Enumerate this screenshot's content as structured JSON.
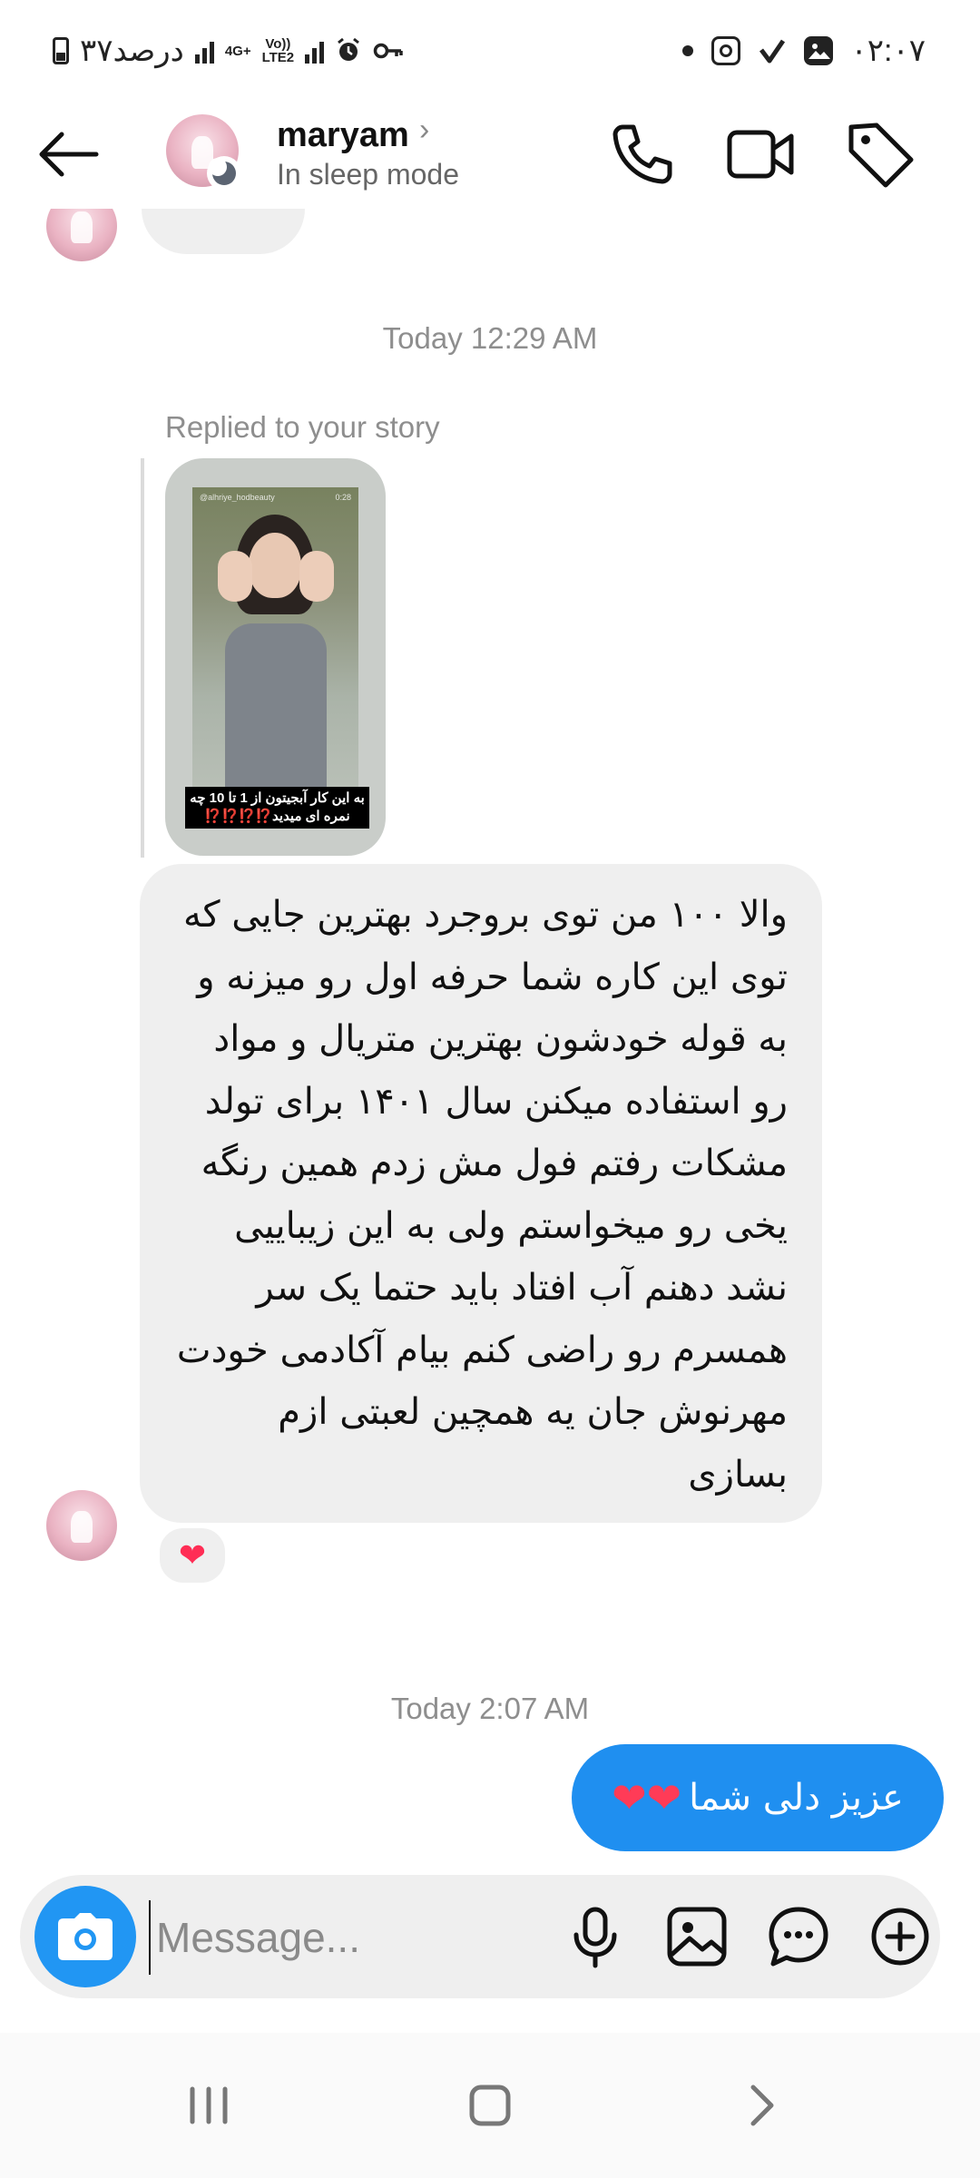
{
  "status_bar": {
    "battery_text": "۳۷درصد",
    "network_4g": "4G+",
    "network_volte": "Vo))",
    "network_lte": "LTE2",
    "time": "۰۲:۰۷"
  },
  "header": {
    "name": "maryam",
    "status": "In sleep mode"
  },
  "chat": {
    "timestamp_1": "Today 12:29 AM",
    "replied_label": "Replied to your story",
    "story": {
      "handle": "@alhriye_hodbeauty",
      "time": "0:28",
      "caption_line1": "به این کار آبجیتون از 1 تا 10 چه",
      "caption_line2": "نمره ای میدید",
      "caption_marks": "⁉️⁉️⁉️⁉️"
    },
    "incoming_message": "والا ۱۰۰ من توی بروجرد بهترین جایی که\nتوی این کاره شما حرفه اول رو میزنه و\nبه قوله خودشون بهترین متریال و مواد\nرو استفاده میکنن سال ۱۴۰۱ برای تولد\nمشکات رفتم فول مش زدم همین رنگه\nیخی رو میخواستم ولی به این زیباییی\nنشد دهنم آب افتاد باید حتما یک سر\nهمسرم رو راضی کنم بیام آکادمی خودت\nمهرنوش جان یه همچین لعبتی ازم\nبسازی",
    "reaction": "❤",
    "timestamp_2": "Today 2:07 AM",
    "outgoing_text": "عزیز دلی شما",
    "outgoing_hearts": "❤❤"
  },
  "composer": {
    "placeholder": "Message..."
  },
  "colors": {
    "outgoing_bubble": "#1f8ff0",
    "incoming_bubble": "#efefef",
    "camera_button": "#2196f3"
  }
}
